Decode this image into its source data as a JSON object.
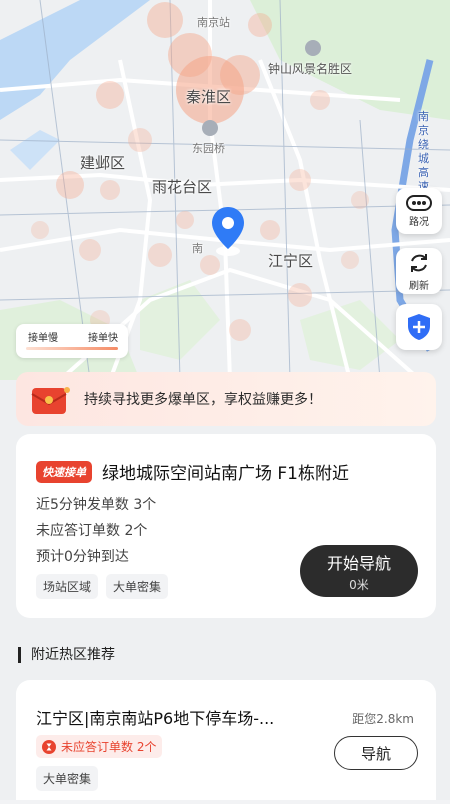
{
  "map": {
    "labels": {
      "nanjing_station": "南京站",
      "zhongshan": "钟山风景名胜区",
      "qinhuai": "秦淮区",
      "dongyuanqiao": "东园桥",
      "jianye": "建邺区",
      "yuhuatai": "雨花台区",
      "jiangning": "江宁区",
      "nan_small": "南",
      "raocheng_expressway": "南京绕城高速"
    }
  },
  "side_buttons": {
    "road": "路况",
    "refresh": "刷新"
  },
  "legend": {
    "slow": "接单慢",
    "fast": "接单快"
  },
  "banner": {
    "text": "持续寻找更多爆单区，享权益赚更多！"
  },
  "main_card": {
    "tag": "快速接单",
    "title": "绿地城际空间站南广场 F1栋附近",
    "stat1": "近5分钟发单数 3个",
    "stat2": "未应答订单数 2个",
    "stat3": "预计0分钟到达",
    "chips": [
      "场站区域",
      "大单密集"
    ],
    "nav_button": "开始导航",
    "nav_distance": "0米"
  },
  "nearby": {
    "section_title": "附近热区推荐",
    "item": {
      "title": "江宁区|南京南站P6地下停车场-...",
      "distance": "距您2.8km",
      "unanswered": "未应答订单数 2个",
      "chip": "大单密集",
      "nav_button": "导航"
    }
  }
}
